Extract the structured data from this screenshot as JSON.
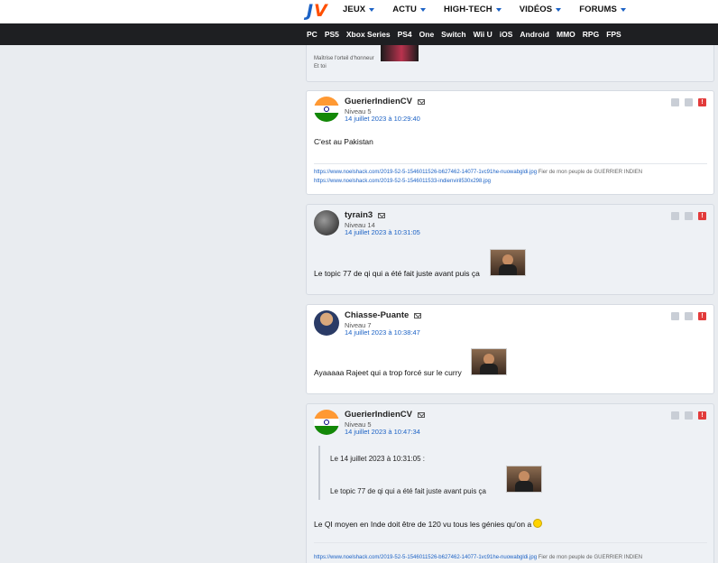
{
  "header": {
    "logo": "JV",
    "nav": [
      "JEUX",
      "ACTU",
      "HIGH-TECH",
      "VIDÉOS",
      "FORUMS"
    ],
    "platforms": [
      "PC",
      "PS5",
      "Xbox Series",
      "PS4",
      "One",
      "Switch",
      "Wii U",
      "iOS",
      "Android",
      "MMO",
      "RPG",
      "FPS"
    ]
  },
  "top_stub": {
    "line1": "Maîtrise l'orteil d'honneur",
    "line2": "Et toi"
  },
  "posts": [
    {
      "author": "GuerierIndienCV",
      "level": "Niveau 5",
      "date": "14 juillet 2023 à 10:29:40",
      "message": "C'est au Pakistan",
      "sig1": "https://www.noelshack.com/2019-52-5-1546011526-b627462-14077-1vc91he-nuowabgldi.jpg",
      "sig1_tail": "Fier de mon peuple de GUERRIER INDIEN",
      "sig2": "https://www.noelshack.com/2019-52-5-1546011533-indienviril530x298.jpg"
    },
    {
      "author": "tyrain3",
      "level": "Niveau 14",
      "date": "14 juillet 2023 à 10:31:05",
      "message": "Le topic 77 de qi qui a été fait juste avant puis ça"
    },
    {
      "author": "Chiasse-Puante",
      "level": "Niveau 7",
      "date": "14 juillet 2023 à 10:38:47",
      "message": "Ayaaaaa Rajeet qui a trop forcé sur le curry"
    },
    {
      "author": "GuerierIndienCV",
      "level": "Niveau 5",
      "date": "14 juillet 2023 à 10:47:34",
      "quote_header": "Le 14 juillet 2023 à 10:31:05 :",
      "quote_text": "Le topic 77 de qi qui a été fait juste avant puis ça",
      "message": "Le QI moyen en Inde doit être de 120 vu tous les génies qu'on a",
      "sig1": "https://www.noelshack.com/2019-52-5-1546011526-b627462-14077-1vc91he-nuowabgldi.jpg",
      "sig1_tail": "Fier de mon peuple de GUERRIER INDIEN"
    }
  ],
  "controls": {
    "alert": "!"
  }
}
